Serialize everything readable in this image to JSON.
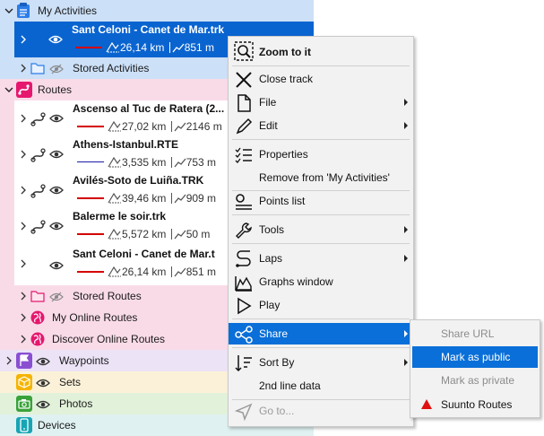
{
  "sections": {
    "my_activities": "My Activities",
    "routes": "Routes",
    "waypoints": "Waypoints",
    "sets": "Sets",
    "photos": "Photos",
    "devices": "Devices"
  },
  "activities": {
    "selected": {
      "name": "Sant Celoni - Canet de Mar.trk",
      "distance": "26,14 km",
      "elevation": "851 m",
      "line_color": "#d40000"
    },
    "stored_folder": "Stored Activities"
  },
  "routes": {
    "items": [
      {
        "name": "Ascenso al Tuc de Ratera (2...",
        "distance": "27,02 km",
        "elevation": "2146 m",
        "line_color": "#d40000"
      },
      {
        "name": "Athens-Istanbul.RTE",
        "distance": "3,535 km",
        "elevation": "753 m",
        "line_color": "#1a1aa6"
      },
      {
        "name": "Avilés-Soto de Luiña.TRK",
        "distance": "39,46 km",
        "elevation": "909 m",
        "line_color": "#d40000"
      },
      {
        "name": "Balerme le soir.trk",
        "distance": "5,572 km",
        "elevation": "50 m",
        "line_color": "#d40000"
      },
      {
        "name": "Sant Celoni - Canet de Mar.t",
        "distance": "26,14 km",
        "elevation": "851 m",
        "line_color": "#d40000"
      }
    ],
    "stored_folder": "Stored Routes",
    "my_online": "My Online Routes",
    "discover_online": "Discover Online Routes"
  },
  "context_menu": {
    "zoom": "Zoom to it",
    "close_track": "Close track",
    "file": "File",
    "edit": "Edit",
    "properties": "Properties",
    "remove": "Remove from 'My Activities'",
    "points_list": "Points list",
    "tools": "Tools",
    "laps": "Laps",
    "graphs": "Graphs window",
    "play": "Play",
    "share": "Share",
    "sort_by": "Sort By",
    "second_line": "2nd line data",
    "go_to": "Go to..."
  },
  "share_submenu": {
    "share_url": "Share URL",
    "mark_public": "Mark as public",
    "mark_private": "Mark as private",
    "suunto": "Suunto Routes"
  },
  "colors": {
    "activities_bg": "#cce0f7",
    "selected_bg": "#0a64d0",
    "routes_bg": "#f9dbe8",
    "waypoints_bg": "#ece3f7",
    "sets_bg": "#fbf1d8",
    "photos_bg": "#e2f2da",
    "devices_bg": "#dff1f1",
    "menu_highlight": "#0a6fd8"
  }
}
